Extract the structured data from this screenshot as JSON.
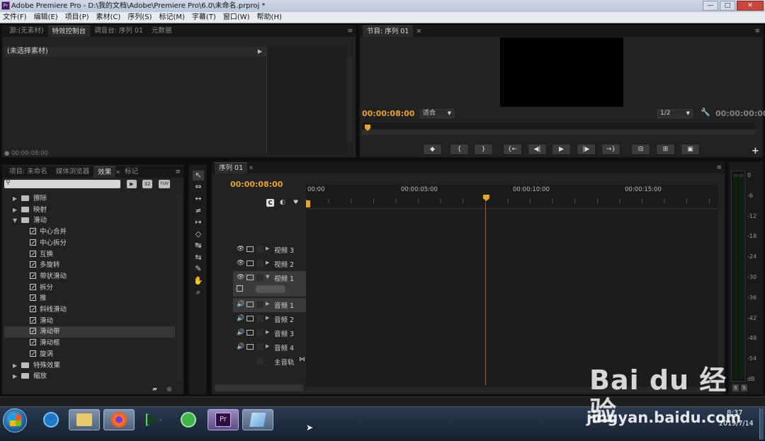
{
  "window": {
    "title": "Adobe Premiere Pro - D:\\我的文档\\Adobe\\Premiere Pro\\6.0\\未命名.prproj *",
    "app_icon": "Pr",
    "controls": [
      "—",
      "□",
      "✕"
    ]
  },
  "menu": [
    "文件(F)",
    "编辑(E)",
    "项目(P)",
    "素材(C)",
    "序列(S)",
    "标记(M)",
    "字幕(T)",
    "窗口(W)",
    "帮助(H)"
  ],
  "source_panel": {
    "tabs": [
      "源:(无素材)",
      "特效控制台",
      "调音台: 序列 01",
      "元数据"
    ],
    "active": 1,
    "header": "(未选择素材)",
    "timecode": "00:00:08:00"
  },
  "program_panel": {
    "tab": "节目: 序列 01",
    "timecode": "00:00:08:00",
    "fit": "适合",
    "res": "1/2",
    "end_timecode": "00:00:00:00",
    "buttons": [
      "◆",
      "{",
      "}",
      "{←",
      "◀|",
      "▶",
      "|▶",
      "→}",
      "⊟",
      "⊞",
      "▣"
    ],
    "plus": "+"
  },
  "effects_panel": {
    "tabs": [
      "项目: 未命名",
      "媒体浏览器",
      "效果",
      "标记"
    ],
    "active": 2,
    "items": [
      {
        "type": "folder",
        "label": "擦除",
        "open": false
      },
      {
        "type": "folder",
        "label": "映射",
        "open": false
      },
      {
        "type": "folder",
        "label": "滑动",
        "open": true
      },
      {
        "type": "fx",
        "label": "中心合并"
      },
      {
        "type": "fx",
        "label": "中心拆分"
      },
      {
        "type": "fx",
        "label": "互换"
      },
      {
        "type": "fx",
        "label": "多旋转"
      },
      {
        "type": "fx",
        "label": "带状滑动"
      },
      {
        "type": "fx",
        "label": "拆分"
      },
      {
        "type": "fx",
        "label": "推"
      },
      {
        "type": "fx",
        "label": "斜线滑动"
      },
      {
        "type": "fx",
        "label": "滑动"
      },
      {
        "type": "fx",
        "label": "滑动带",
        "selected": true
      },
      {
        "type": "fx",
        "label": "滑动框"
      },
      {
        "type": "fx",
        "label": "旋涡"
      },
      {
        "type": "folder",
        "label": "特殊效果",
        "open": false
      },
      {
        "type": "folder",
        "label": "缩放",
        "open": false
      }
    ],
    "search_icons": [
      "32",
      "YUV"
    ]
  },
  "tools": [
    "↖",
    "⇔",
    "↔",
    "≠",
    "↦",
    "◇",
    "↹",
    "⇆",
    "✎",
    "✋",
    "⌕"
  ],
  "timeline": {
    "tab": "序列 01",
    "timecode": "00:00:08:00",
    "ruler": [
      "00:00",
      "00:00:05:00",
      "00:00:10:00",
      "00:00:15:00"
    ],
    "tracks": [
      {
        "label": "视频 3",
        "kind": "video"
      },
      {
        "label": "视频 2",
        "kind": "video"
      },
      {
        "label": "视频 1",
        "kind": "video",
        "expanded": true
      },
      {
        "label": "音频 1",
        "kind": "audio",
        "highlight": true
      },
      {
        "label": "音频 2",
        "kind": "audio"
      },
      {
        "label": "音频 3",
        "kind": "audio"
      },
      {
        "label": "音频 4",
        "kind": "audio"
      },
      {
        "label": "主音轨",
        "kind": "master"
      }
    ]
  },
  "vu": {
    "ticks": [
      "0",
      "-6",
      "-12",
      "-18",
      "-24",
      "-30",
      "-36",
      "-42",
      "-48",
      "-54",
      "dB"
    ],
    "buttons": [
      "S",
      "S"
    ]
  },
  "taskbar": {
    "clock": "8:37",
    "date": "2019/7/14"
  },
  "watermark": {
    "logo": "Bai du 经验",
    "url": "jingyan.baidu.com"
  },
  "colors": {
    "accent": "#e8a428",
    "playhead": "#c84a2a",
    "panel": "#222222"
  }
}
